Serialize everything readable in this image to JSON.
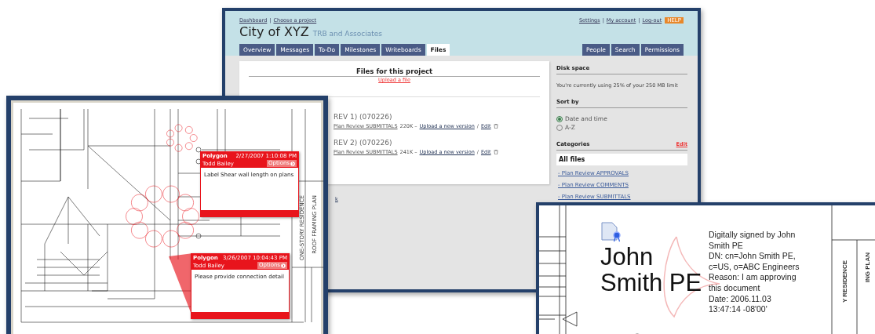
{
  "project_window": {
    "breadcrumbs": [
      {
        "kind": "link",
        "label": "Dashboard"
      },
      {
        "kind": "separator",
        "label": "|"
      },
      {
        "kind": "link",
        "label": "Choose a project"
      }
    ],
    "top_links": [
      {
        "kind": "link",
        "label": "Settings"
      },
      {
        "kind": "separator",
        "label": "|"
      },
      {
        "kind": "link",
        "label": "My account"
      },
      {
        "kind": "separator",
        "label": "|"
      },
      {
        "kind": "link",
        "label": "Log-out"
      }
    ],
    "help_badge": "HELP",
    "title": "City of XYZ",
    "subtitle": "TRB and Associates",
    "tabs": [
      {
        "label": "Overview",
        "selected": false
      },
      {
        "label": "Messages",
        "selected": false
      },
      {
        "label": "To-Do",
        "selected": false
      },
      {
        "label": "Milestones",
        "selected": false
      },
      {
        "label": "Writeboards",
        "selected": false
      },
      {
        "label": "Files",
        "selected": true
      }
    ],
    "right_tabs": [
      {
        "label": "People",
        "selected": false
      },
      {
        "label": "Search",
        "selected": false
      },
      {
        "label": "Permissions",
        "selected": false
      }
    ],
    "files_heading": "Files for this project",
    "upload_link": "Upload a file",
    "files": [
      {
        "name": "REV 1) (070226)",
        "category": "Plan Review SUBMITTALS",
        "size": "220K –",
        "upload_link": "Upload a new version",
        "separator": "/",
        "edit_link": "Edit"
      },
      {
        "name": "REV 2) (070226)",
        "category": "Plan Review SUBMITTALS",
        "size": "241K –",
        "upload_link": "Upload a new version",
        "separator": "/",
        "edit_link": "Edit"
      }
    ],
    "footer_link": "k",
    "sidebar": {
      "disk_heading": "Disk space",
      "disk_text": "You're currently using 25% of your 250 MB limit",
      "sort_heading": "Sort by",
      "sort_options": [
        {
          "label": "Date and time",
          "selected": true
        },
        {
          "label": "A-Z",
          "selected": false
        }
      ],
      "categories_heading": "Categories",
      "categories_edit": "Edit",
      "categories": [
        {
          "label": "All files",
          "selected": true
        },
        {
          "label": "- Plan Review APPROVALS",
          "selected": false
        },
        {
          "label": "- Plan Review COMMENTS",
          "selected": false
        },
        {
          "label": "- Plan Review SUBMITTALS",
          "selected": false
        }
      ]
    }
  },
  "markup_window": {
    "title_block": [
      "ONE-STORY RESIDENCE",
      "ROOF FRAMING PLAN"
    ],
    "comments": [
      {
        "type": "Polygon",
        "date": "2/27/2007 1:10:08 PM",
        "author": "Todd Bailey",
        "options": "Options",
        "text": "Label Shear wall length on plans"
      },
      {
        "type": "Polygon",
        "date": "3/26/2007 10:04:43 PM",
        "author": "Todd Bailey",
        "options": "Options",
        "text": "Please provide connection detail"
      }
    ]
  },
  "signature_window": {
    "name_lines": [
      "John",
      "Smith PE"
    ],
    "details": [
      "Digitally signed by John",
      "Smith PE",
      "DN: cn=John Smith PE,",
      "c=US, o=ABC Engineers",
      "Reason: I am approving",
      "this document",
      "Date: 2006.11.03",
      "13:47:14 -08'00'"
    ],
    "title_block": [
      "Y RESIDENCE",
      "ING PLAN"
    ]
  }
}
